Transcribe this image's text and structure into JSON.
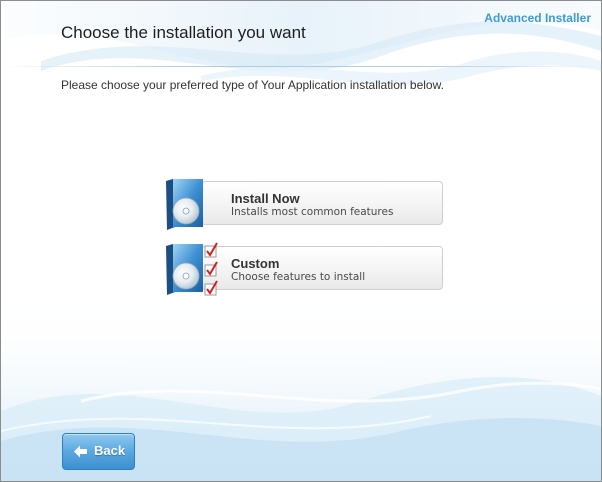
{
  "brand": {
    "name": "Advanced Installer"
  },
  "header": {
    "title": "Choose the installation you want",
    "subtitle": "Please choose your preferred type of Your Application installation below."
  },
  "options": [
    {
      "label": "Install Now",
      "description": "Installs most common features",
      "icon": "software-box-cd-icon"
    },
    {
      "label": "Custom",
      "description": "Choose features to install",
      "icon": "software-box-cd-checklist-icon"
    }
  ],
  "footer": {
    "back_label": "Back",
    "back_icon": "arrow-left-icon"
  },
  "colors": {
    "brand_text": "#3d9bd4",
    "button_blue": "#5aa8e0",
    "check_red": "#d42020"
  }
}
